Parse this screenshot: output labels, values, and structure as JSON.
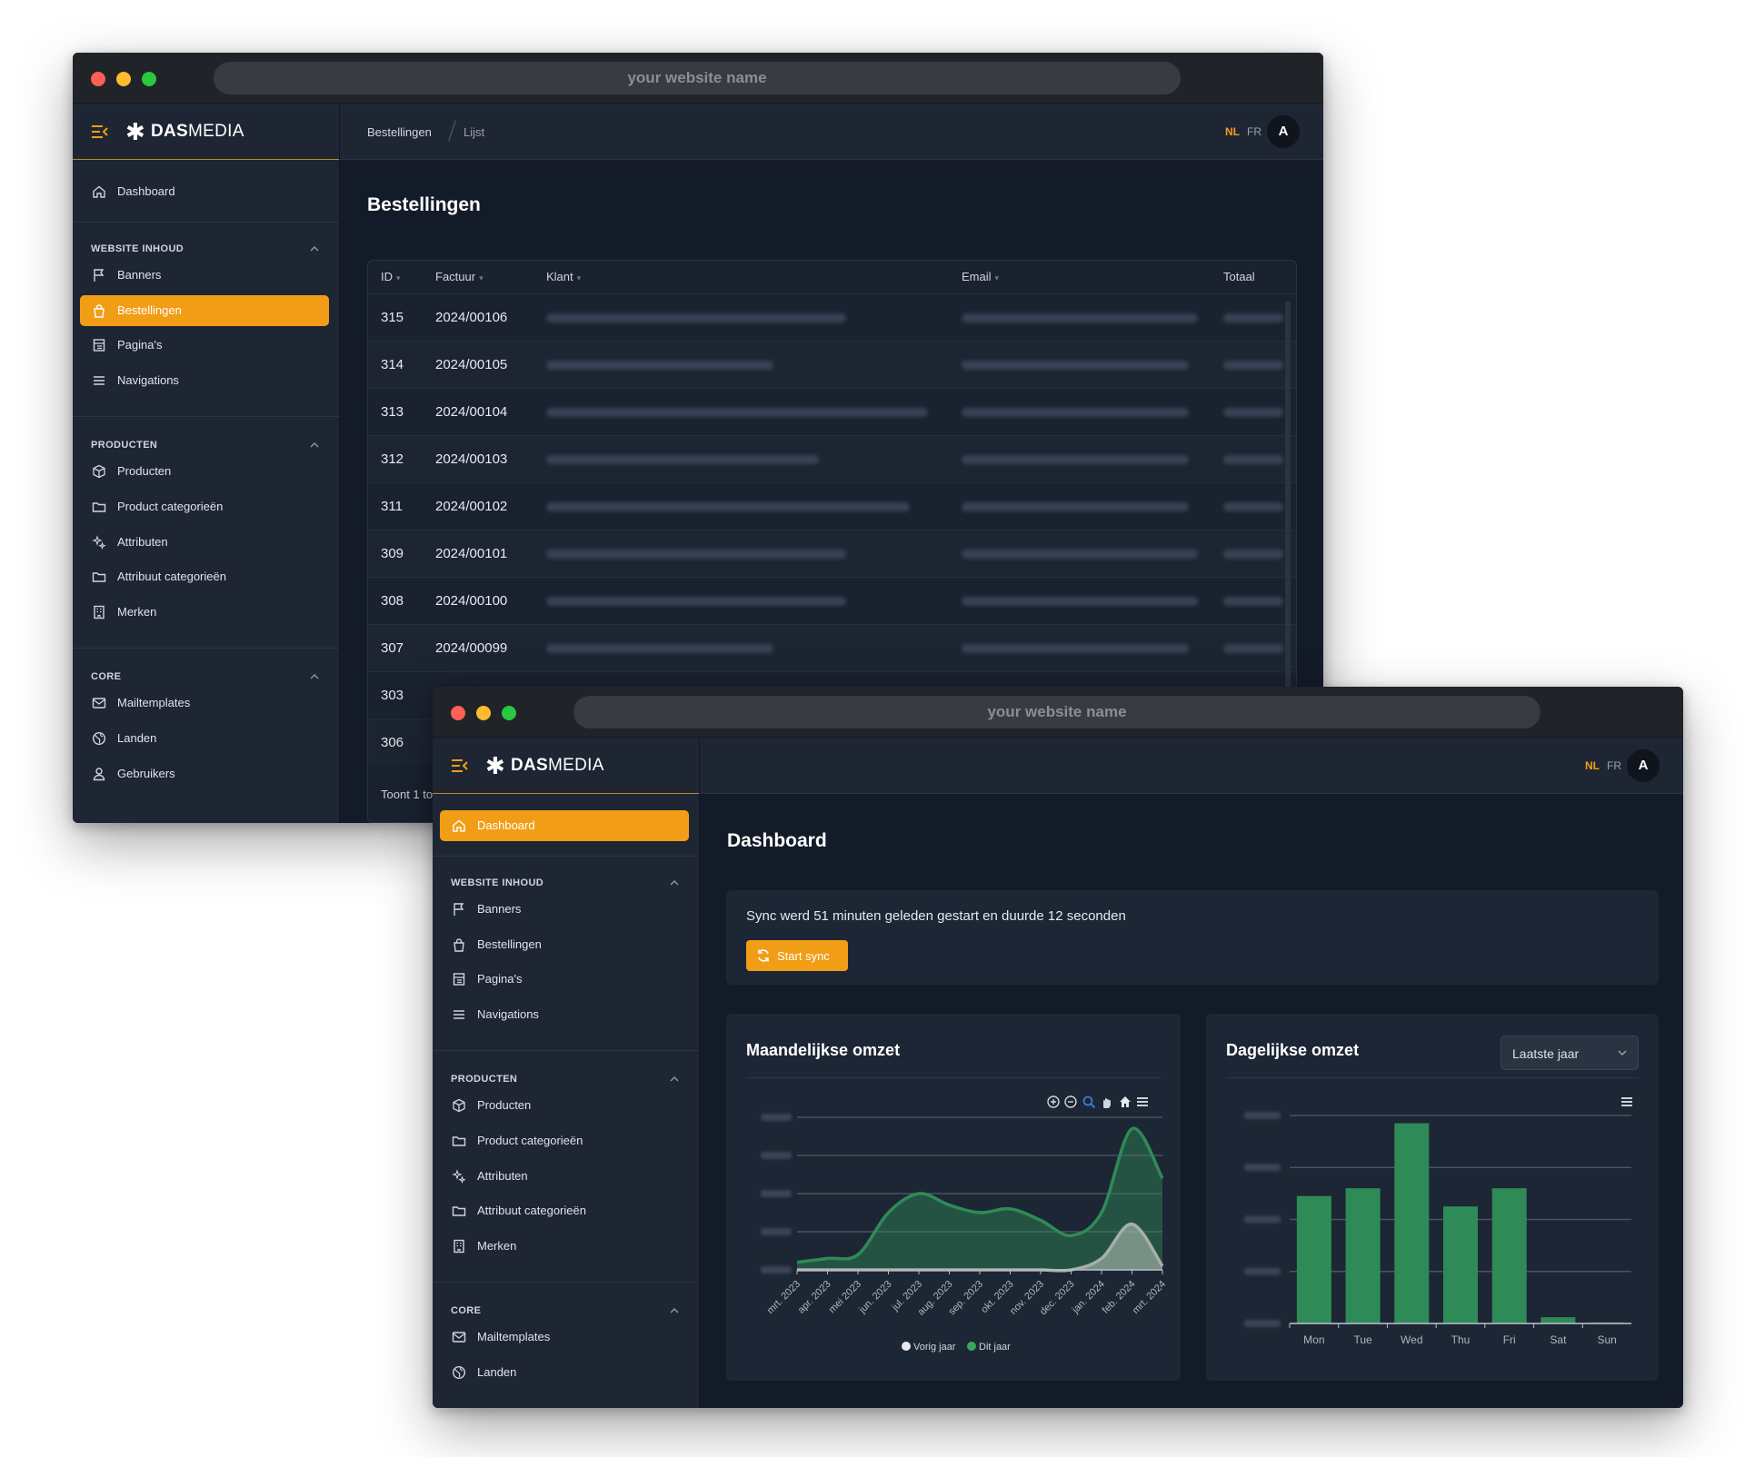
{
  "back_window": {
    "url": "your website name",
    "brand": {
      "bold": "DAS",
      "rest": "MEDIA"
    },
    "breadcrumb": [
      "Bestellingen",
      "Lijst"
    ],
    "lang": {
      "active": "NL",
      "other": "FR"
    },
    "avatar": "A",
    "sidebar": {
      "dashboard": "Dashboard",
      "sections": [
        {
          "title": "WEBSITE INHOUD",
          "items": [
            "Banners",
            "Bestellingen",
            "Pagina's",
            "Navigations"
          ]
        },
        {
          "title": "PRODUCTEN",
          "items": [
            "Producten",
            "Product categorieën",
            "Attributen",
            "Attribuut categorieën",
            "Merken"
          ]
        },
        {
          "title": "CORE",
          "items": [
            "Mailtemplates",
            "Landen",
            "Gebruikers"
          ]
        }
      ],
      "active": "Bestellingen"
    },
    "page_title": "Bestellingen",
    "table": {
      "columns": [
        "ID",
        "Factuur",
        "Klant",
        "Email",
        "Totaal"
      ],
      "rows": [
        {
          "id": "315",
          "factuur": "2024/00106"
        },
        {
          "id": "314",
          "factuur": "2024/00105"
        },
        {
          "id": "313",
          "factuur": "2024/00104"
        },
        {
          "id": "312",
          "factuur": "2024/00103"
        },
        {
          "id": "311",
          "factuur": "2024/00102"
        },
        {
          "id": "309",
          "factuur": "2024/00101"
        },
        {
          "id": "308",
          "factuur": "2024/00100"
        },
        {
          "id": "307",
          "factuur": "2024/00099"
        },
        {
          "id": "303",
          "factuur": ""
        },
        {
          "id": "306",
          "factuur": ""
        }
      ],
      "footer": "Toont 1 to"
    }
  },
  "front_window": {
    "url": "your website name",
    "brand": {
      "bold": "DAS",
      "rest": "MEDIA"
    },
    "lang": {
      "active": "NL",
      "other": "FR"
    },
    "avatar": "A",
    "sidebar": {
      "dashboard": "Dashboard",
      "sections": [
        {
          "title": "WEBSITE INHOUD",
          "items": [
            "Banners",
            "Bestellingen",
            "Pagina's",
            "Navigations"
          ]
        },
        {
          "title": "PRODUCTEN",
          "items": [
            "Producten",
            "Product categorieën",
            "Attributen",
            "Attribuut categorieën",
            "Merken"
          ]
        },
        {
          "title": "CORE",
          "items": [
            "Mailtemplates",
            "Landen"
          ]
        }
      ],
      "active": "Dashboard"
    },
    "page_title": "Dashboard",
    "sync": {
      "message": "Sync werd 51 minuten geleden gestart en duurde 12 seconden",
      "button": "Start sync"
    },
    "monthly_title": "Maandelijkse omzet",
    "daily_title": "Dagelijkse omzet",
    "daily_filter": "Laatste jaar"
  },
  "colors": {
    "accent": "#f19e16",
    "this_year": "#2e8b57",
    "prev_year": "#a8aea8"
  },
  "chart_data": [
    {
      "type": "area",
      "title": "Maandelijkse omzet",
      "x": [
        "mrt. 2023",
        "apr. 2023",
        "mei 2023",
        "jun. 2023",
        "jul. 2023",
        "aug. 2023",
        "sep. 2023",
        "okt. 2023",
        "nov. 2023",
        "dec. 2023",
        "jan. 2024",
        "feb. 2024",
        "mrt. 2024"
      ],
      "ylim": [
        0,
        4
      ],
      "series": [
        {
          "name": "Vorig jaar",
          "values": [
            0,
            0,
            0,
            0,
            0,
            0,
            0,
            0,
            0,
            0,
            0.3,
            1.2,
            0.1
          ],
          "color": "#a8aea8"
        },
        {
          "name": "Dit jaar",
          "values": [
            0.2,
            0.3,
            0.4,
            1.5,
            2.0,
            1.7,
            1.5,
            1.6,
            1.3,
            0.9,
            1.5,
            3.7,
            2.4
          ],
          "color": "#2e8b57"
        }
      ],
      "legend": "bottom",
      "toolbar_icons": [
        "zoom-in-icon",
        "zoom-out-icon",
        "selection-zoom-icon",
        "pan-icon",
        "reset-home-icon",
        "menu-icon"
      ],
      "y_tick_labels_blurred": true
    },
    {
      "type": "bar",
      "title": "Dagelijkse omzet",
      "categories": [
        "Mon",
        "Tue",
        "Wed",
        "Thu",
        "Fri",
        "Sat",
        "Sun"
      ],
      "values": [
        2.45,
        2.6,
        3.85,
        2.25,
        2.6,
        0.12,
        0.02
      ],
      "ylim": [
        0,
        4
      ],
      "color": "#2e8b57",
      "y_tick_labels_blurred": true
    }
  ]
}
